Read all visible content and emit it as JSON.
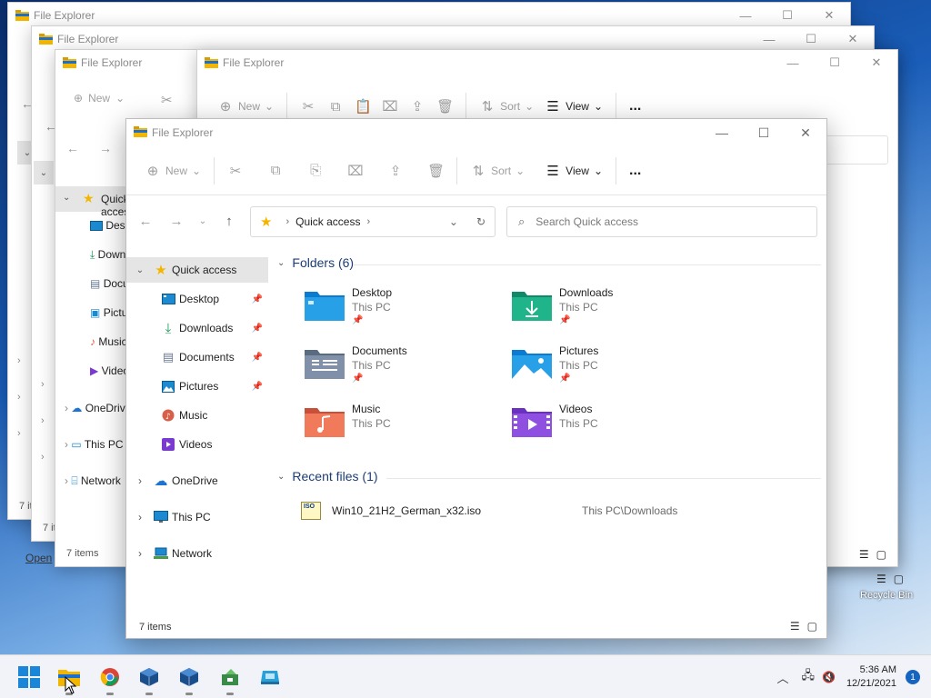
{
  "app_title": "File Explorer",
  "bg_status": "7 items",
  "bg_sidebar": {
    "quick": "Quick access",
    "desktop": "Desktop",
    "downloads": "Downloads",
    "documents": "Documents",
    "pictures": "Pictures",
    "music": "Music",
    "videos": "Videos",
    "onedrive": "OneDrive",
    "thispc": "This PC",
    "network": "Network",
    "open": "Open"
  },
  "toolbar": {
    "new_label": "New",
    "sort_label": "Sort",
    "view_label": "View",
    "more_label": "..."
  },
  "address": {
    "location": "Quick access"
  },
  "search": {
    "placeholder": "Search Quick access"
  },
  "sidebar": {
    "items": [
      {
        "label": "Quick access"
      },
      {
        "label": "Desktop"
      },
      {
        "label": "Downloads"
      },
      {
        "label": "Documents"
      },
      {
        "label": "Pictures"
      },
      {
        "label": "Music"
      },
      {
        "label": "Videos"
      },
      {
        "label": "OneDrive"
      },
      {
        "label": "This PC"
      },
      {
        "label": "Network"
      }
    ]
  },
  "folders_section": {
    "title": "Folders (6)",
    "items": [
      {
        "name": "Desktop",
        "location": "This PC"
      },
      {
        "name": "Downloads",
        "location": "This PC"
      },
      {
        "name": "Documents",
        "location": "This PC"
      },
      {
        "name": "Pictures",
        "location": "This PC"
      },
      {
        "name": "Music",
        "location": "This PC"
      },
      {
        "name": "Videos",
        "location": "This PC"
      }
    ]
  },
  "recent_section": {
    "title": "Recent files (1)",
    "items": [
      {
        "name": "Win10_21H2_German_x32.iso",
        "location": "This PC\\Downloads",
        "icon_text": "ISO"
      }
    ]
  },
  "status": {
    "item_count": "7 items"
  },
  "taskbar": {
    "time": "5:36 AM",
    "date": "12/21/2021",
    "notification_count": "1"
  },
  "desktop": {
    "recycle_bin": "Recycle Bin"
  },
  "colors": {
    "accent": "#0067c0",
    "folder_yellow": "#f2b600",
    "header_blue": "#1c3d75"
  }
}
